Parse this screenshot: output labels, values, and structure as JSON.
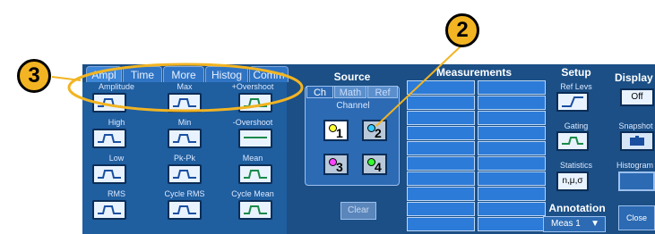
{
  "tabs": [
    "Ampl",
    "Time",
    "More",
    "Histog",
    "Comm"
  ],
  "measurements": [
    {
      "label": "Amplitude",
      "icon": "amplitude-icon"
    },
    {
      "label": "Max",
      "icon": "max-icon"
    },
    {
      "label": "+Overshoot",
      "icon": "positive-overshoot-icon"
    },
    {
      "label": "High",
      "icon": "high-icon"
    },
    {
      "label": "Min",
      "icon": "min-icon"
    },
    {
      "label": "-Overshoot",
      "icon": "negative-overshoot-icon"
    },
    {
      "label": "Low",
      "icon": "low-icon"
    },
    {
      "label": "Pk-Pk",
      "icon": "pk-pk-icon"
    },
    {
      "label": "Mean",
      "icon": "mean-icon"
    },
    {
      "label": "RMS",
      "icon": "rms-icon"
    },
    {
      "label": "Cycle RMS",
      "icon": "cycle-rms-icon"
    },
    {
      "label": "Cycle Mean",
      "icon": "cycle-mean-icon"
    }
  ],
  "source": {
    "title": "Source",
    "tabs": [
      "Ch",
      "Math",
      "Ref"
    ],
    "channel_label": "Channel",
    "channels": [
      "1",
      "2",
      "3",
      "4"
    ],
    "channel_colors": [
      "#ffff00",
      "#33ccff",
      "#ff44ff",
      "#33ff33"
    ]
  },
  "measurements_header": "Measurements",
  "clear_label": "Clear",
  "setup": {
    "title": "Setup",
    "ref_levs": "Ref Levs",
    "gating": "Gating",
    "statistics": "Statistics",
    "statistics_btn": "n,μ,σ",
    "annotation": "Annotation",
    "annotation_value": "Meas 1"
  },
  "display": {
    "title": "Display",
    "off": "Off",
    "snapshot": "Snapshot",
    "histogram": "Histogram",
    "close": "Close"
  },
  "callouts": [
    "2",
    "3"
  ]
}
